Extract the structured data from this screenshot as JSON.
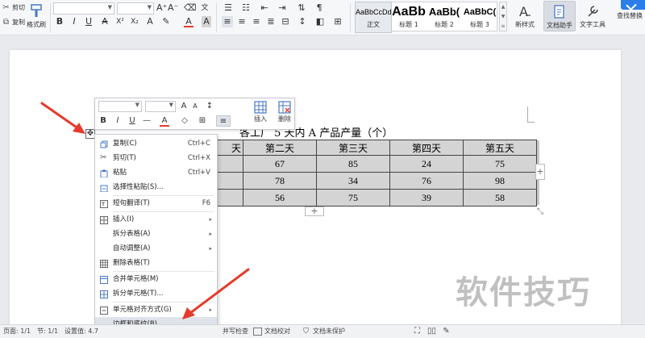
{
  "ribbon": {
    "cut_label": "剪切",
    "copy_label": "复制",
    "format_painter_label": "格式刷",
    "bold": "B",
    "italic": "I",
    "underline": "U",
    "strike": "A",
    "grow_font": "A⁺",
    "shrink_font": "A⁻",
    "font_color_letter": "A",
    "char_shade_letter": "A",
    "styles": [
      {
        "preview": "AaBbCcDd",
        "label": "正文"
      },
      {
        "preview": "AaBb",
        "label": "标题 1"
      },
      {
        "preview": "AaBb(",
        "label": "标题 2"
      },
      {
        "preview": "AaBbC(",
        "label": "标题 3"
      }
    ],
    "new_style_label": "新样式",
    "doc_helper_label": "文档助手",
    "text_tools_label": "文字工具",
    "find_replace_label": "查找替换"
  },
  "document": {
    "title": "各工厂 5 天内 A 产品产量（个）",
    "header_row": [
      "",
      "第二天",
      "第三天",
      "第四天",
      "第五天"
    ],
    "header_partial_first": "天",
    "rows": [
      [
        "",
        "67",
        "85",
        "24",
        "75"
      ],
      [
        "",
        "78",
        "34",
        "76",
        "98"
      ],
      [
        "",
        "56",
        "75",
        "39",
        "58"
      ]
    ]
  },
  "mini_toolbar": {
    "bold": "B",
    "italic": "I",
    "underline": "U",
    "grow": "A",
    "shrink": "A",
    "insert_label": "插入",
    "delete_label": "删除"
  },
  "context_menu": {
    "items": [
      {
        "label": "复制(C)",
        "shortcut": "Ctrl+C",
        "icon": "copy-icon"
      },
      {
        "label": "剪切(T)",
        "shortcut": "Ctrl+X",
        "icon": "scissors-icon"
      },
      {
        "label": "粘贴",
        "shortcut": "Ctrl+V",
        "icon": "paste-icon"
      },
      {
        "label": "选择性粘贴(S)...",
        "shortcut": "",
        "icon": "paste-special-icon"
      },
      {
        "label": "短句翻译(T)",
        "shortcut": "F6",
        "icon": "translate-icon"
      },
      {
        "label": "插入(I)",
        "shortcut": "",
        "icon": "insert-icon"
      },
      {
        "label": "拆分表格(A)",
        "shortcut": "",
        "icon": ""
      },
      {
        "label": "自动调整(A)",
        "shortcut": "",
        "icon": ""
      },
      {
        "label": "删除表格(T)",
        "shortcut": "",
        "icon": "delete-table-icon"
      },
      {
        "label": "合并单元格(M)",
        "shortcut": "",
        "icon": "merge-cells-icon"
      },
      {
        "label": "拆分单元格(T)...",
        "shortcut": "",
        "icon": "split-cells-icon"
      },
      {
        "label": "单元格对齐方式(G)",
        "shortcut": "",
        "icon": "cell-align-icon"
      },
      {
        "label": "边框和底纹(B)...",
        "shortcut": "",
        "icon": ""
      }
    ]
  },
  "watermark": "软件技巧",
  "status_bar": {
    "page": "页面: 1/1",
    "section": "节: 1/1",
    "setting": "设置值: 4.7",
    "spell_check": "并写检查",
    "doc_proof": "文档校对",
    "doc_protect": "文档未保护"
  },
  "colors": {
    "accent": "#2b7de9",
    "arrow": "#e53b2c",
    "table_fill": "#d4d4d4",
    "highlight": "#dfe3ea"
  }
}
